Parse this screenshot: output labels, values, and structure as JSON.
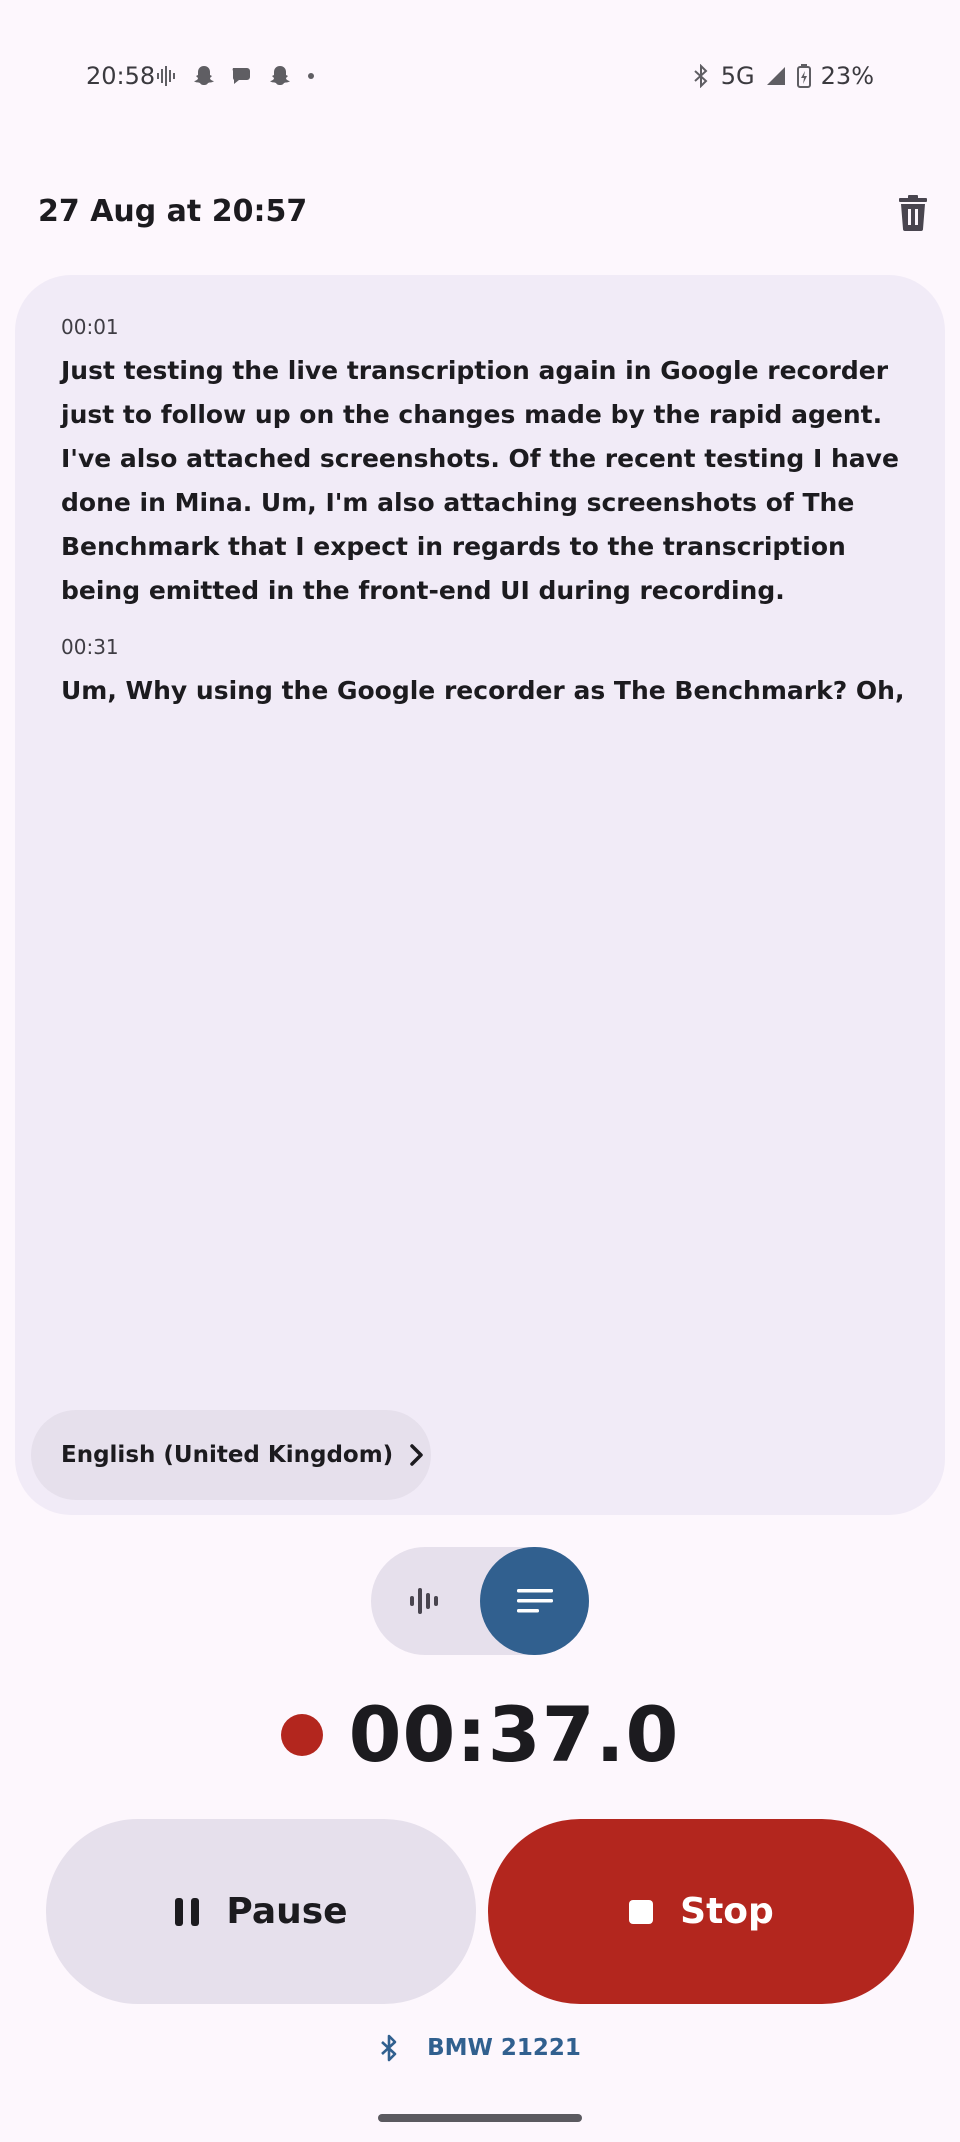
{
  "status_bar": {
    "time": "20:58",
    "network": "5G",
    "battery": "23%"
  },
  "header": {
    "title": "27 Aug at 20:57"
  },
  "transcript": {
    "segments": [
      {
        "time": "00:01",
        "text": "Just testing the live transcription again in Google recorder just to follow up on the changes made by the rapid agent. I've also attached screenshots. Of the recent testing I have done in Mina. Um, I'm also attaching screenshots of The Benchmark that I expect in regards to the transcription being emitted in the front-end UI during recording."
      },
      {
        "time": "00:31",
        "text": "Um, Why using the Google recorder as The Benchmark? Oh,"
      }
    ],
    "language": "English (United Kingdom)"
  },
  "view_toggle": {
    "selected": "transcript"
  },
  "recorder": {
    "elapsed": "00:37.0",
    "pause_label": "Pause",
    "stop_label": "Stop"
  },
  "bluetooth": {
    "device": "BMW 21221"
  },
  "colors": {
    "background": "#fdf7fd",
    "card": "#f1ebf7",
    "accent": "#31608f",
    "record_red": "#b3261e"
  }
}
